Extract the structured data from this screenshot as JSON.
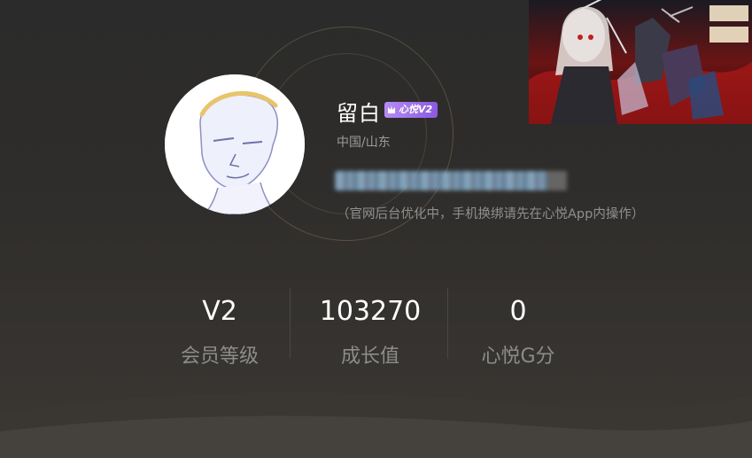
{
  "profile": {
    "username": "留白",
    "vip_badge": "心悦V2",
    "location": "中国/山东",
    "notice": "（官网后台优化中，手机换绑请先在心悦App内操作）"
  },
  "stats": [
    {
      "value": "V2",
      "label": "会员等级"
    },
    {
      "value": "103270",
      "label": "成长值"
    },
    {
      "value": "0",
      "label": "心悦G分"
    }
  ],
  "colors": {
    "background": "#2b2b2b",
    "badge_purple": "#9a6ae8",
    "label_gray": "#8c8c8c",
    "ring_gold": "#c8aa78"
  },
  "icons": {
    "badge_icon": "crown-icon"
  }
}
